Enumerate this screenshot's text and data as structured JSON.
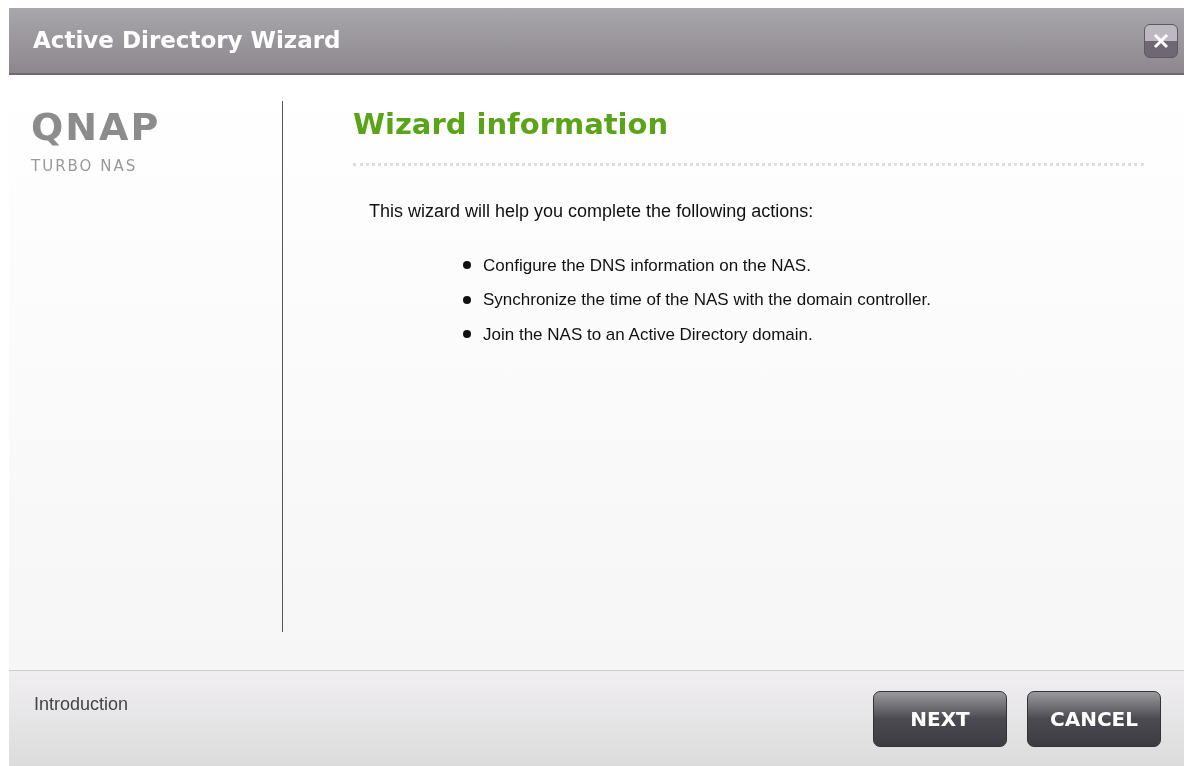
{
  "window": {
    "title": "Active Directory Wizard"
  },
  "sidebar": {
    "logo": "QNAP",
    "tagline": "TURBO NAS"
  },
  "content": {
    "heading": "Wizard information",
    "intro": "This wizard will help you complete the following actions:",
    "actions": [
      "Configure the DNS information on the NAS.",
      "Synchronize the time of the NAS with the domain controller.",
      "Join the NAS to an Active Directory domain."
    ]
  },
  "footer": {
    "step": "Introduction",
    "buttons": [
      "NEXT",
      "CANCEL"
    ]
  }
}
